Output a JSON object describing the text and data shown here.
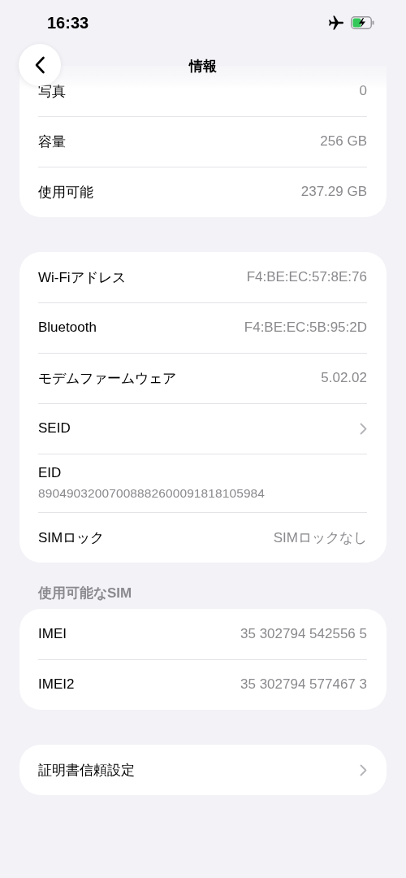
{
  "status_bar": {
    "time": "16:33"
  },
  "nav": {
    "title": "情報"
  },
  "groups": [
    {
      "clipped_top": true,
      "rows": [
        {
          "kind": "value",
          "label": "写真",
          "value": "0"
        },
        {
          "kind": "value",
          "label": "容量",
          "value": "256 GB"
        },
        {
          "kind": "value",
          "label": "使用可能",
          "value": "237.29 GB"
        }
      ]
    },
    {
      "rows": [
        {
          "kind": "value",
          "label": "Wi-Fiアドレス",
          "value": "F4:BE:EC:57:8E:76"
        },
        {
          "kind": "value",
          "label": "Bluetooth",
          "value": "F4:BE:EC:5B:95:2D"
        },
        {
          "kind": "value",
          "label": "モデムファームウェア",
          "value": "5.02.02"
        },
        {
          "kind": "link",
          "label": "SEID"
        },
        {
          "kind": "stacked",
          "label": "EID",
          "value": "89049032007008882600091818105984"
        },
        {
          "kind": "value",
          "label": "SIMロック",
          "value": "SIMロックなし"
        }
      ]
    },
    {
      "header": "使用可能なSIM",
      "rows": [
        {
          "kind": "value",
          "label": "IMEI",
          "value": "35 302794 542556 5"
        },
        {
          "kind": "value",
          "label": "IMEI2",
          "value": "35 302794 577467 3"
        }
      ]
    },
    {
      "rows": [
        {
          "kind": "link",
          "label": "証明書信頼設定"
        }
      ]
    }
  ]
}
